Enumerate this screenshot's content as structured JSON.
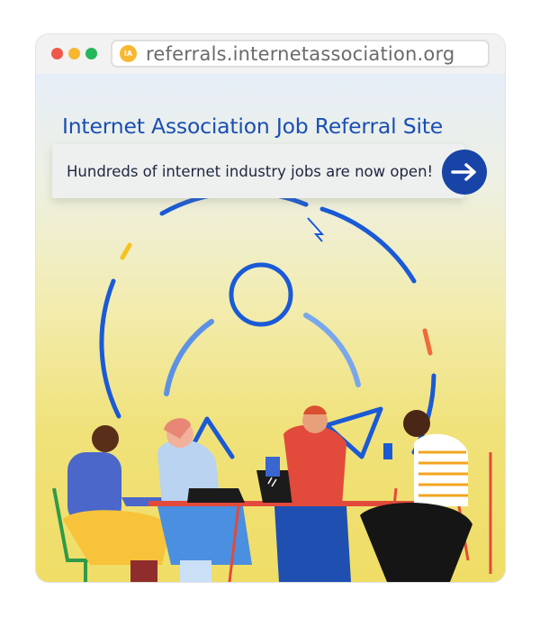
{
  "browser": {
    "window_controls": [
      "close",
      "minimize",
      "maximize"
    ],
    "site_icon_text": "IA",
    "url": "referrals.internetassociation.org"
  },
  "page": {
    "title": "Internet Association Job Referral Site",
    "banner_text": "Hundreds of internet industry jobs are now open!",
    "cta_icon": "arrow-right-icon"
  },
  "colors": {
    "title": "#1a4fb3",
    "button": "#1744a6",
    "gradient_top": "#e6eef8",
    "gradient_bottom": "#efdd66"
  }
}
